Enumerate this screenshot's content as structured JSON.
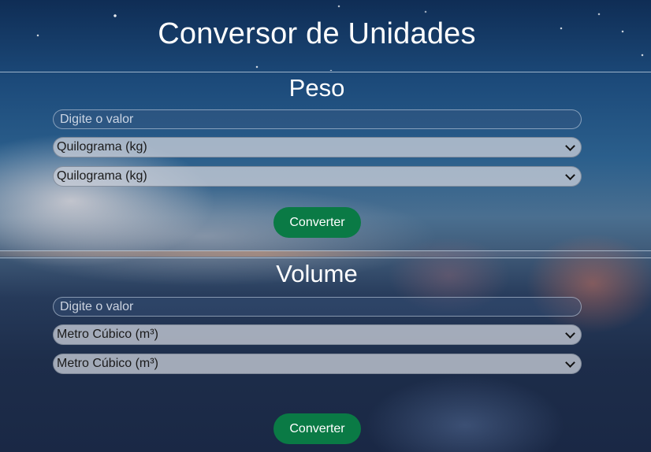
{
  "app": {
    "title": "Conversor de Unidades"
  },
  "sections": [
    {
      "title": "Peso",
      "input_placeholder": "Digite o valor",
      "input_value": "",
      "from_unit": "Quilograma (kg)",
      "to_unit": "Quilograma (kg)",
      "button_label": "Converter"
    },
    {
      "title": "Volume",
      "input_placeholder": "Digite o valor",
      "input_value": "",
      "from_unit": "Metro Cúbico (m³)",
      "to_unit": "Metro Cúbico (m³)",
      "button_label": "Converter"
    }
  ],
  "icons": {
    "select_arrow": "chevron-down-icon"
  },
  "colors": {
    "button_bg": "#0a7a45",
    "select_bg": "#c8cdd7",
    "text": "#ffffff"
  }
}
